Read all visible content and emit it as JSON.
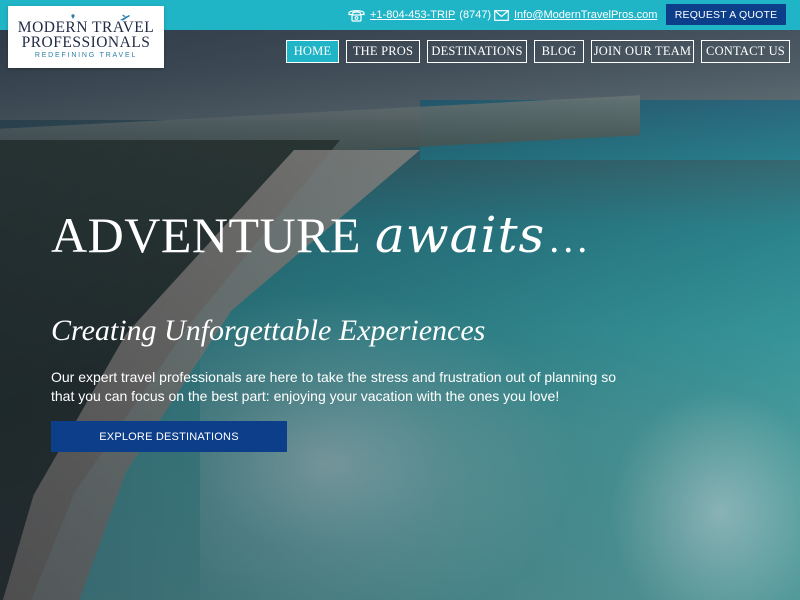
{
  "topbar": {
    "phone_link": "+1-804-453-TRIP",
    "phone_suffix": "(8747)",
    "email": "Info@ModernTravelPros.com",
    "quote_button": "REQUEST A QUOTE",
    "bg_color": "#1fb5c7"
  },
  "logo": {
    "line1": "MODERN TRAVEL",
    "line2": "PROFESSIONALS",
    "tagline": "REDEFINING TRAVEL"
  },
  "nav": {
    "items": [
      {
        "label": "HOME",
        "active": true
      },
      {
        "label": "THE PROS"
      },
      {
        "label": "DESTINATIONS"
      },
      {
        "label": "BLOG"
      },
      {
        "label": "JOIN OUR TEAM"
      },
      {
        "label": "CONTACT US"
      }
    ]
  },
  "hero": {
    "headline_main": "ADVENTURE",
    "headline_script": "awaits",
    "headline_dots": "...",
    "subheadline": "Creating Unforgettable Experiences",
    "paragraph": "Our expert travel professionals are here to take the stress and frustration out of planning so that you can focus on the best part: enjoying your vacation with the ones you love!",
    "cta_button": "EXPLORE DESTINATIONS"
  },
  "colors": {
    "accent_teal": "#1fb5c7",
    "button_navy": "#0c3e8a"
  }
}
